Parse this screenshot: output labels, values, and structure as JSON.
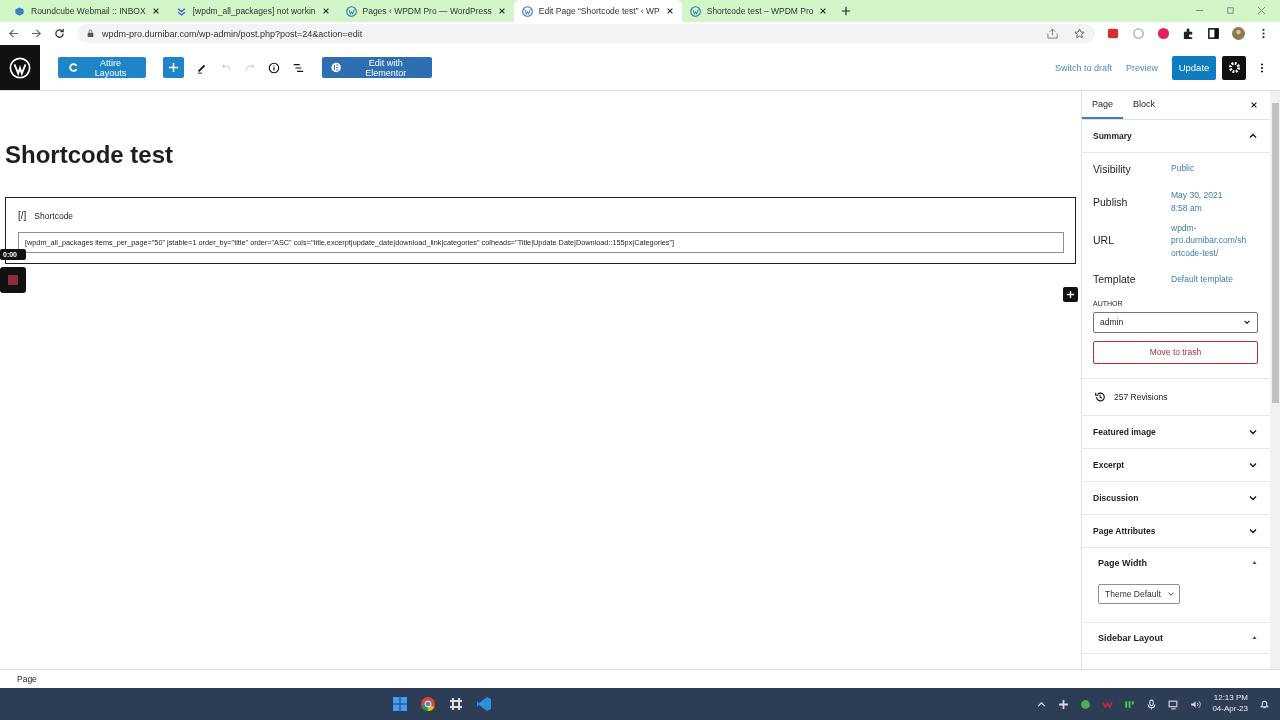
{
  "browser": {
    "tabs": [
      {
        "title": "Roundcube Webmail :: INBOX",
        "selected": false
      },
      {
        "title": "[wpdm_all_packages] not workin",
        "selected": false
      },
      {
        "title": "Pages ‹ WPDM Pro — WordPress",
        "selected": false
      },
      {
        "title": "Edit Page “Shortcode test” ‹ WP",
        "selected": true
      },
      {
        "title": "Shortcode test – WPDM Pro",
        "selected": false
      }
    ],
    "url": "wpdm-pro.durnibar.com/wp-admin/post.php?post=24&action=edit"
  },
  "toolbar": {
    "attire_button": "Attire Layouts",
    "elementor_button": "Edit with Elementor",
    "switch_to_draft": "Switch to draft",
    "preview": "Preview",
    "update": "Update"
  },
  "editor": {
    "title": "Shortcode test",
    "block_icon": "[/]",
    "block_label": "Shortcode",
    "shortcode": "[wpdm_all_packages items_per_page=\"50\" jstable=1 order_by=\"title\" order=\"ASC\" cols=\"title,excerpt|update_date|download_link|categories\" colheads=\"Title|Update Date|Download::155px|Categories\"]",
    "recorder_time": "0:00"
  },
  "sidebar": {
    "tabs": [
      {
        "label": "Page",
        "selected": true
      },
      {
        "label": "Block",
        "selected": false
      }
    ],
    "summary": {
      "title": "Summary",
      "expanded": true,
      "rows": [
        {
          "label": "Visibility",
          "value": "Public"
        },
        {
          "label": "Publish",
          "value": "May 30, 2021\n8:58 am"
        },
        {
          "label": "URL",
          "value": "wpdm-\npro.durnibar.com/sh\nortcode-test/"
        },
        {
          "label": "Template",
          "value": "Default template"
        }
      ],
      "author_label": "AUTHOR",
      "author": "admin",
      "trash": "Move to trash"
    },
    "revisions": "257 Revisions",
    "panels": [
      {
        "title": "Featured image",
        "expanded": false
      },
      {
        "title": "Excerpt",
        "expanded": false
      },
      {
        "title": "Discussion",
        "expanded": false
      },
      {
        "title": "Page Attributes",
        "expanded": false
      }
    ],
    "meta_boxes": [
      {
        "title": "Page Width",
        "expanded": true,
        "select": "Theme Default"
      },
      {
        "title": "Sidebar Layout",
        "expanded": true
      }
    ]
  },
  "footer": {
    "breadcrumb": "Page"
  },
  "taskbar": {
    "time": "12:13 PM",
    "date": "04-Apr-23"
  }
}
